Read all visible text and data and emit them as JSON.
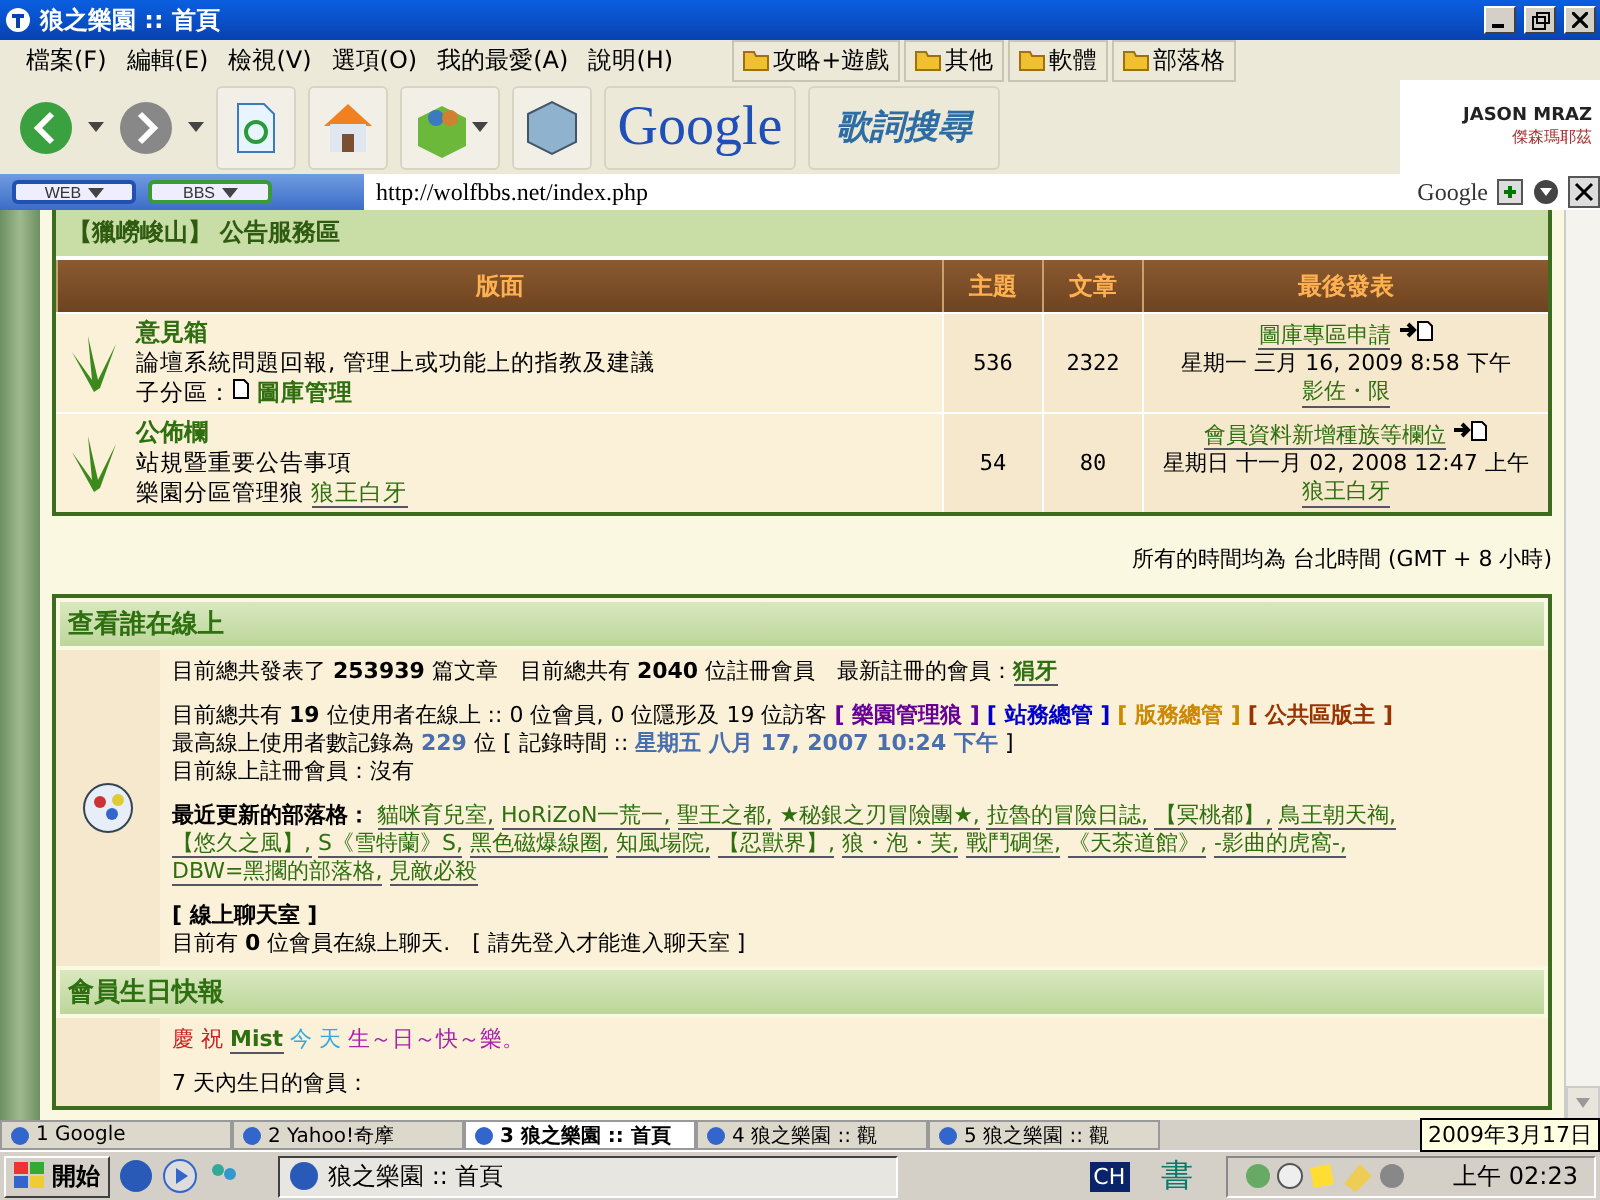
{
  "window": {
    "title": "狼之樂園 :: 首頁"
  },
  "menu": [
    "檔案(F)",
    "編輯(E)",
    "檢視(V)",
    "選項(O)",
    "我的最愛(A)",
    "說明(H)"
  ],
  "bookmarks": [
    "攻略+遊戲",
    "其他",
    "軟體",
    "部落格"
  ],
  "toolbar": {
    "google_logo": "Google",
    "lyrics_logo": "歌詞搜尋",
    "banner_text": "JASON MRAZ",
    "banner_sub": "傑森瑪耶茲"
  },
  "search_buttons": [
    "WEB",
    "BBS"
  ],
  "address": {
    "url": "http://wolfbbs.net/index.php",
    "engine": "Google"
  },
  "forum": {
    "category": "【獵嶗峻山】 公告服務區",
    "columns": [
      "版面",
      "主題",
      "文章",
      "最後發表"
    ],
    "rows": [
      {
        "name": "意見箱",
        "desc": "論壇系統問題回報, 管理上或功能上的指教及建議",
        "extra_label": "子分區：",
        "extra_link": "圖庫管理",
        "topics": "536",
        "posts": "2322",
        "last_title": "圖庫專區申請",
        "last_date": "星期一 三月 16, 2009 8:58 下午",
        "last_user": "影佐・限"
      },
      {
        "name": "公佈欄",
        "desc": "站規暨重要公告事項",
        "extra_label": "樂園分區管理狼",
        "extra_link": "狼王白牙",
        "topics": "54",
        "posts": "80",
        "last_title": "會員資料新增種族等欄位",
        "last_date": "星期日 十一月 02, 2008 12:47 上午",
        "last_user": "狼王白牙"
      }
    ]
  },
  "timezone": "所有的時間均為 台北時間 (GMT + 8 小時)",
  "online": {
    "title": "查看誰在線上",
    "stats": "目前總共發表了 **253939** 篇文章　目前總共有 **2040** 位註冊會員　最新註冊的會員：",
    "newest": "狷牙",
    "users": "目前總共有 **19** 位使用者在線上 :: 0 位會員, 0 位隱形及 19 位訪客",
    "groups": [
      {
        "name": "[ 樂園管理狼 ]",
        "color": "#660099"
      },
      {
        "name": "[ 站務總管 ]",
        "color": "#0000cc"
      },
      {
        "name": "[ 版務總管 ]",
        "color": "#cc8800"
      },
      {
        "name": "[ 公共區版主 ]",
        "color": "#993300"
      }
    ],
    "record_label": "最高線上使用者數記錄為",
    "record_count": "229",
    "record_unit": "位 [ 記錄時間 ::",
    "record_time": "星期五 八月 17, 2007 10:24 下午",
    "record_end": "]",
    "registered": "目前線上註冊會員：沒有",
    "blogs_label": "最近更新的部落格：",
    "blogs": [
      "貓咪育兒室,",
      "HoRiZoN一荒一,",
      "聖王之都,",
      "★秘銀之刃冒險團★,",
      "拉魯的冒險日誌,",
      "【冥桃都】,",
      "鳥王朝天祹,",
      "【悠久之風】,",
      "S《雪特蘭》S,",
      "黑色磁爆線圈,",
      "知風場院,",
      "【忍獸界】,",
      "狼・泡・芙,",
      "戰鬥碉堡,",
      "《天茶道館》,",
      "-影曲的虎窩-,",
      "DBW=黑擱的部落格,",
      "見敵必殺"
    ]
  },
  "chat": {
    "title": "[ 線上聊天室 ]",
    "text": "目前有 **0** 位會員在線上聊天.　[ 請先登入才能進入聊天室 ]"
  },
  "birthday": {
    "title": "會員生日快報",
    "greet1": "慶 祝",
    "member": "Mist",
    "greet2": "今 天",
    "greet3": "生～日～快～樂。",
    "week_label": "7 天內生日的會員："
  },
  "tabs": [
    {
      "label": "1 Google",
      "selected": false
    },
    {
      "label": "2 Yahoo!奇摩",
      "selected": false
    },
    {
      "label": "3 狼之樂園 :: 首頁",
      "selected": true
    },
    {
      "label": "4 狼之樂園 :: 觀",
      "selected": false
    },
    {
      "label": "5 狼之樂園 :: 觀",
      "selected": false
    }
  ],
  "taskbar": {
    "start": "開始",
    "task": "狼之樂園 :: 首頁",
    "lang": "CH",
    "ime": "書",
    "clock": "上午 02:23",
    "tooltip": "2009年3月17日"
  }
}
